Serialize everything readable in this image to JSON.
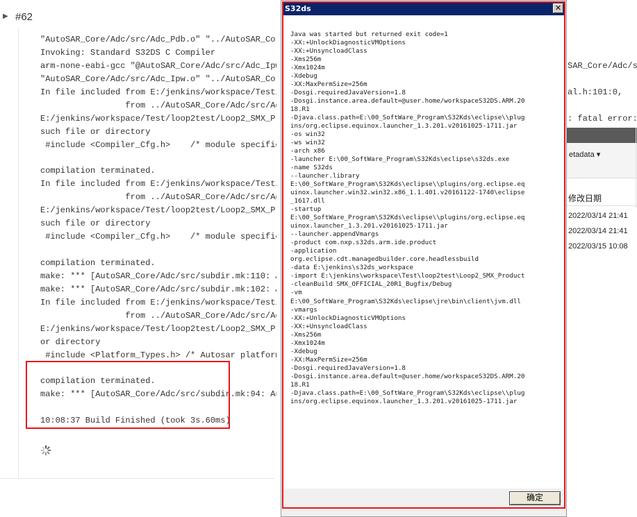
{
  "jenkins": {
    "build_number": "#62",
    "console_lines": [
      "\"AutoSAR_Core/Adc/src/Adc_Pdb.o\" \"../AutoSAR_Core/",
      "Invoking: Standard S32DS C Compiler",
      "arm-none-eabi-gcc \"@AutoSAR_Core/Adc/src/Adc_Ipw.",
      "\"AutoSAR_Core/Adc/src/Adc_Ipw.o\" \"../AutoSAR_Core/",
      "In file included from E:/jenkins/workspace/Test/lo",
      "                 from ../AutoSAR_Core/Adc/src/Adc_",
      "E:/jenkins/workspace/Test/loop2test/Loop2_SMX_Proc",
      "such file or directory",
      " #include <Compiler_Cfg.h>    /* module specific",
      "",
      "compilation terminated.",
      "In file included from E:/jenkins/workspace/Test/",
      "                 from ../AutoSAR_Core/Adc/src/Ad",
      "E:/jenkins/workspace/Test/loop2test/Loop2_SMX_Pr",
      "such file or directory",
      " #include <Compiler_Cfg.h>    /* module specific",
      "",
      "compilation terminated.",
      "make: *** [AutoSAR_Core/Adc/src/subdir.mk:110: A",
      "make: *** [AutoSAR_Core/Adc/src/subdir.mk:102: A",
      "In file included from E:/jenkins/workspace/Test/",
      "                 from ../AutoSAR_Core/Adc/src/Ad",
      "E:/jenkins/workspace/Test/loop2test/Loop2_SMX_Pr",
      "or directory",
      " #include <Platform_Types.h> /* Autosar platform",
      "",
      "compilation terminated.",
      "make: *** [AutoSAR_Core/Adc/src/subdir.mk:94: Au",
      "",
      "10:08:37 Build Finished (took 3s.60ms)"
    ],
    "right_fragments": {
      "line_a": "SAR_Core/Adc/sr",
      "line_b": "al.h:101:0,",
      "line_c": ": fatal error:"
    }
  },
  "explorer": {
    "metadata_label": "etadata ▾",
    "column_modified": "修改日期",
    "dates": [
      "2022/03/14 21:41",
      "2022/03/14 21:41",
      "2022/03/15 10:08"
    ]
  },
  "dialog": {
    "title": "S32ds",
    "close_glyph": "✕",
    "ok_label": "确定",
    "message_lines": [
      "Java was started but returned exit code=1",
      "-XX:+UnlockDiagnosticVMOptions",
      "-XX:+UnsyncloadClass",
      "-Xms256m",
      "-Xmx1024m",
      "-Xdebug",
      "-XX:MaxPermSize=256m",
      "-Dosgi.requiredJavaVersion=1.8",
      "-Dosgi.instance.area.default=@user.home/workspaceS32DS.ARM.20",
      "18.R1",
      "-Djava.class.path=E:\\00_SoftWare_Program\\S32Kds\\eclipse\\\\plug",
      "ins/org.eclipse.equinox.launcher_1.3.201.v20161025-1711.jar",
      "-os win32",
      "-ws win32",
      "-arch x86",
      "-launcher E:\\00_SoftWare_Program\\S32Kds\\eclipse\\s32ds.exe",
      "-name S32ds",
      "--launcher.library",
      "E:\\00_SoftWare_Program\\S32Kds\\eclipse\\\\plugins/org.eclipse.eq",
      "uinox.launcher.win32.win32.x86_1.1.401.v20161122-1740\\eclipse",
      "_1617.dll",
      "-startup",
      "E:\\00_SoftWare_Program\\S32Kds\\eclipse\\\\plugins/org.eclipse.eq",
      "uinox.launcher_1.3.201.v20161025-1711.jar",
      "--launcher.appendVmargs",
      "-product com.nxp.s32ds.arm.ide.product",
      "-application",
      "org.eclipse.cdt.managedbuilder.core.headlessbuild",
      "-data E:\\jenkins\\s32ds_workspace",
      "-import E:\\jenkins\\workspace\\Test\\loop2test\\Loop2_SMX_Product",
      "-cleanBuild SMX_OFFICIAL_20R1_Bugfix/Debug",
      "-vm",
      "E:\\00_SoftWare_Program\\S32Kds\\eclipse\\jre\\bin\\client\\jvm.dll",
      "-vmargs",
      "-XX:+UnlockDiagnosticVMOptions",
      "-XX:+UnsyncloadClass",
      "-Xms256m",
      "-Xmx1024m",
      "-Xdebug",
      "-XX:MaxPermSize=256m",
      "-Dosgi.requiredJavaVersion=1.8",
      "-Dosgi.instance.area.default=@user.home/workspaceS32DS.ARM.20",
      "18.R1",
      "-Djava.class.path=E:\\00_SoftWare_Program\\S32Kds\\eclipse\\\\plug",
      "ins/org.eclipse.equinox.launcher_1.3.201.v20161025-1711.jar"
    ]
  },
  "colors": {
    "highlight": "#e8161a",
    "titlebar": "#0a246a"
  }
}
